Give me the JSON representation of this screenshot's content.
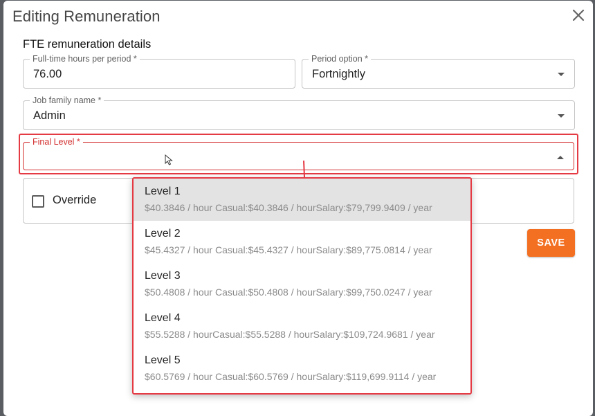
{
  "dialog": {
    "title": "Editing Remuneration",
    "section_title": "FTE remuneration details"
  },
  "fields": {
    "hours": {
      "label": "Full-time hours per period *",
      "value": "76.00"
    },
    "period": {
      "label": "Period option *",
      "value": "Fortnightly"
    },
    "job_family": {
      "label": "Job family name *",
      "value": "Admin"
    },
    "final_level": {
      "label": "Final Level *",
      "value": ""
    }
  },
  "override": {
    "label": "Override"
  },
  "save_label": "SAVE",
  "dropdown": {
    "options": [
      {
        "name": "Level 1",
        "detail": "$40.3846 / hour  Casual:$40.3846 / hourSalary:$79,799.9409 / year"
      },
      {
        "name": "Level 2",
        "detail": "$45.4327 / hour  Casual:$45.4327 / hourSalary:$89,775.0814 / year"
      },
      {
        "name": "Level 3",
        "detail": "$50.4808 / hour  Casual:$50.4808 / hourSalary:$99,750.0247 / year"
      },
      {
        "name": "Level 4",
        "detail": "$55.5288 / hourCasual:$55.5288 / hourSalary:$109,724.9681 / year"
      },
      {
        "name": "Level 5",
        "detail": "$60.5769 / hour Casual:$60.5769 / hourSalary:$119,699.9114 / year"
      }
    ]
  },
  "colors": {
    "accent": "#f36f21",
    "error": "#d32f2f",
    "annotation": "#e53a44"
  }
}
